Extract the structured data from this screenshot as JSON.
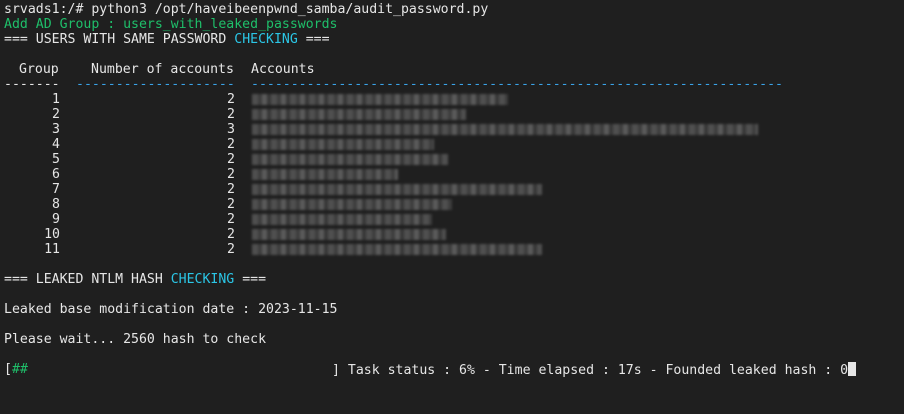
{
  "terminal": {
    "command_line": "srvads1:/# python3 /opt/haveibeenpwnd_samba/audit_password.py",
    "add_group_line": "Add AD Group : users_with_leaked_passwords",
    "section1": {
      "prefix": "=== USERS WITH SAME PASSWORD ",
      "keyword": "CHECKING",
      "suffix": " ==="
    },
    "table": {
      "headers": {
        "group": "Group",
        "count": "Number of accounts",
        "accounts": "Accounts"
      },
      "separators": {
        "group": "-------",
        "count": "--------------------",
        "accounts": "-------------------------------------------------------------------"
      },
      "rows": [
        {
          "group": "1",
          "count": "2"
        },
        {
          "group": "2",
          "count": "2"
        },
        {
          "group": "3",
          "count": "3"
        },
        {
          "group": "4",
          "count": "2"
        },
        {
          "group": "5",
          "count": "2"
        },
        {
          "group": "6",
          "count": "2"
        },
        {
          "group": "7",
          "count": "2"
        },
        {
          "group": "8",
          "count": "2"
        },
        {
          "group": "9",
          "count": "2"
        },
        {
          "group": "10",
          "count": "2"
        },
        {
          "group": "11",
          "count": "2"
        }
      ]
    },
    "section2": {
      "prefix": "=== LEAKED NTLM HASH ",
      "keyword": "CHECKING",
      "suffix": " ==="
    },
    "modification_line": "Leaked base modification date : 2023-11-15",
    "wait_line": "Please wait... 2560 hash to check",
    "progress": {
      "open": "[",
      "bar": "##",
      "close": "]",
      "fraction": 0.06,
      "status_text": " Task status : 6% - Time elapsed : 17s - Founded leaked hash : 0"
    },
    "colors": {
      "text": "#e6e6e6",
      "green": "#1fbf6a",
      "cyan": "#2bc6e6",
      "background": "#1f1f1f"
    }
  }
}
